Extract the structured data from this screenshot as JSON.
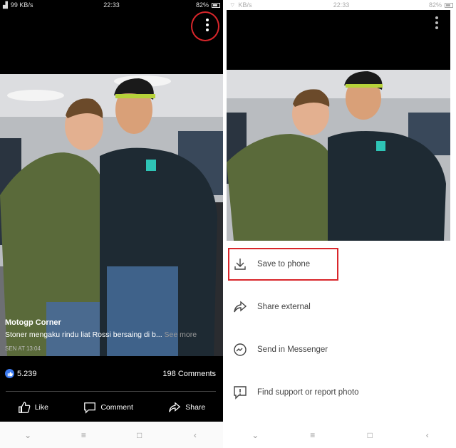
{
  "left": {
    "status": {
      "speed": "99 KB/s",
      "time": "22:33",
      "battery": "82%"
    },
    "post": {
      "page_name": "Motogp Corner",
      "caption": "Stoner mengaku  rindu liat Rossi bersaing di b...",
      "see_more": "See more",
      "timestamp": "SEN AT 13:04"
    },
    "stats": {
      "likes": "5.239",
      "comments": "198 Comments"
    },
    "actions": {
      "like": "Like",
      "comment": "Comment",
      "share": "Share"
    }
  },
  "right": {
    "status": {
      "speed": "KB/s",
      "time": "22:33",
      "battery": "82%"
    },
    "menu": {
      "save": "Save to phone",
      "share_external": "Share external",
      "messenger": "Send in Messenger",
      "report": "Find support or report photo"
    }
  },
  "navbar": {
    "back": "‹",
    "home": "□",
    "menu": "≡",
    "down": "⌄"
  },
  "colors": {
    "highlight": "#d9262b",
    "like_blue": "#3b7af0",
    "jacket_green": "#5a6a3a",
    "jacket_dark": "#1e2a33"
  },
  "icons": [
    "kebab-menu-icon",
    "thumbs-up-icon",
    "comment-icon",
    "share-icon",
    "download-icon",
    "share-arrow-icon",
    "messenger-icon",
    "report-icon"
  ]
}
